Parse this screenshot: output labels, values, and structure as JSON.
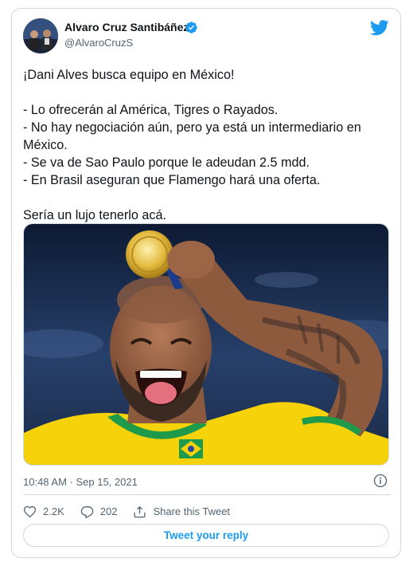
{
  "author": {
    "name": "Alvaro Cruz Santibáñez",
    "handle": "@AlvaroCruzS"
  },
  "tweet": {
    "text": "¡Dani Alves busca equipo en México!\n\n- Lo ofrecerán al América, Tigres o Rayados.\n- No hay negociación aún, pero ya está un intermediario en México.\n- Se va de Sao Paulo porque le adeudan 2.5 mdd.\n- En Brasil aseguran que Flamengo hará una oferta.\n\nSería un lujo tenerlo acá.",
    "timestamp": "10:48 AM · Sep 15, 2021"
  },
  "actions": {
    "likes": "2.2K",
    "replies": "202",
    "share_label": "Share this Tweet"
  },
  "reply_button_label": "Tweet your reply",
  "colors": {
    "accent": "#1d9bf0",
    "text": "#0f1419",
    "muted": "#536471",
    "border": "#cfd9de",
    "jersey_yellow": "#f5d20a",
    "jersey_green": "#1f9a4a"
  },
  "icons": [
    "verified-badge-icon",
    "twitter-bird-icon",
    "info-icon",
    "heart-icon",
    "reply-icon",
    "share-icon"
  ]
}
